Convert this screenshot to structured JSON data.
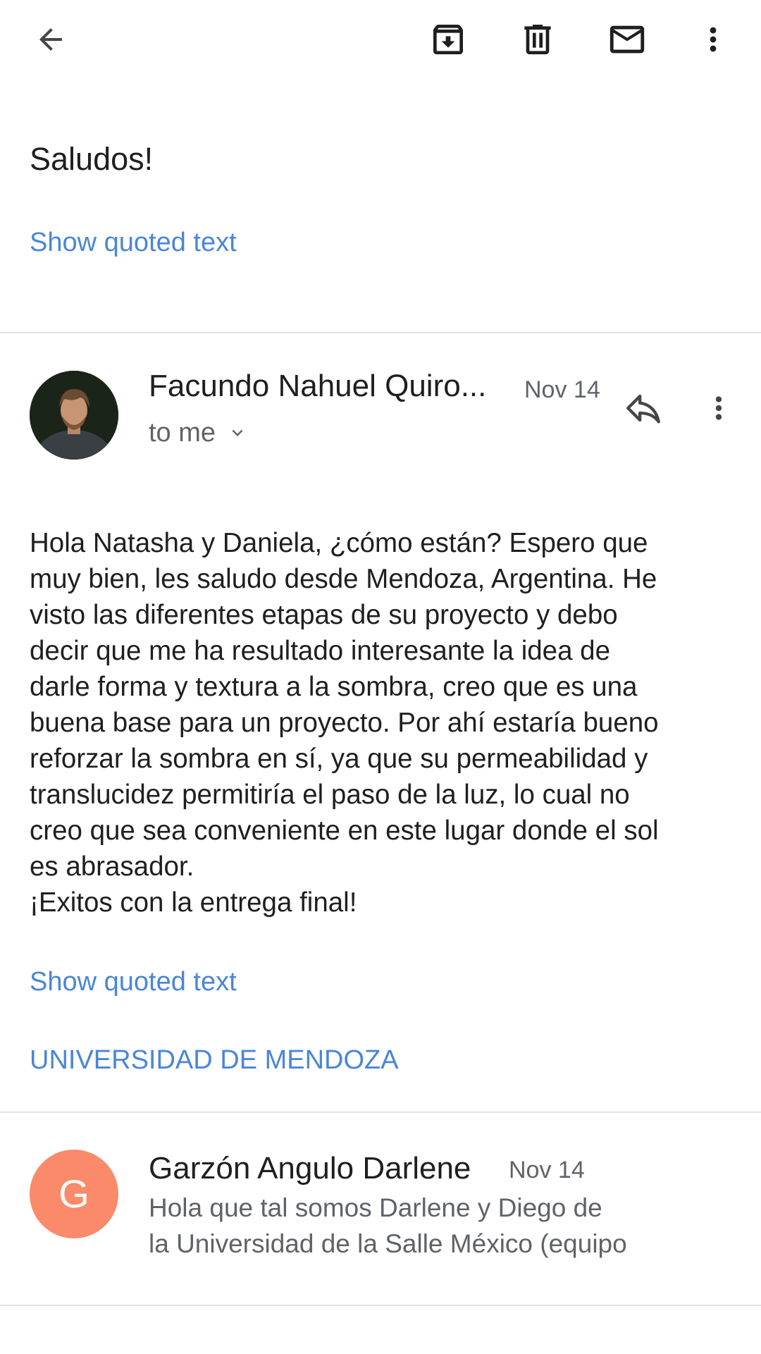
{
  "toolbar": {
    "back_icon": "arrow-left-icon",
    "archive_icon": "archive-icon",
    "delete_icon": "trash-icon",
    "mark_unread_icon": "mail-icon",
    "more_icon": "more-vert-icon"
  },
  "previous_message": {
    "body": "Saludos!",
    "show_quoted": "Show quoted text"
  },
  "message": {
    "sender": "Facundo Nahuel Quiro...",
    "date": "Nov 14",
    "recipient": "to me",
    "body": "Hola Natasha y Daniela, ¿cómo están? Espero que\nmuy bien, les saludo desde Mendoza, Argentina. He\nvisto las diferentes etapas de su proyecto y debo\ndecir que me ha resultado interesante la idea de\ndarle forma y textura a la sombra, creo que es una\nbuena base para un proyecto. Por ahí estaría bueno\nreforzar la sombra en sí, ya que su permeabilidad y\ntranslucidez permitiría el paso de la luz, lo cual no\ncreo que sea conveniente en este lugar donde el sol\nes abrasador.\n¡Exitos con la entrega final!",
    "show_quoted": "Show quoted text",
    "signature": "UNIVERSIDAD DE MENDOZA"
  },
  "next_message": {
    "avatar_letter": "G",
    "sender": "Garzón Angulo Darlene",
    "date": "Nov 14",
    "snippet": "Hola que tal somos Darlene y Diego de\nla Universidad de la Salle México (equipo"
  },
  "colors": {
    "link": "#4a86d8",
    "secondary_text": "#5f6368",
    "avatar_g": "#fb8a6a",
    "divider": "#e3e3e3"
  }
}
